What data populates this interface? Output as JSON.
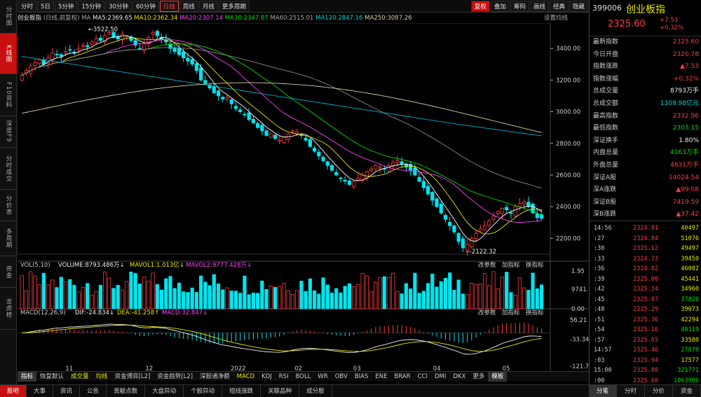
{
  "sidebar": {
    "items": [
      "分时图",
      "K线图",
      "F10资料",
      "深度F9",
      "分时成交",
      "分价表",
      "多周期",
      "资金",
      "龙虎榜"
    ]
  },
  "toolbar": {
    "periods": [
      "分时",
      "5日",
      "5分钟",
      "15分钟",
      "30分钟",
      "60分钟",
      "日线",
      "周线",
      "月线",
      "更多周期"
    ],
    "selected_period": "日线",
    "right_buttons": [
      "复权",
      "叠加",
      "筹码",
      "画线",
      "经典",
      "隐藏"
    ]
  },
  "legend": {
    "index_name": "创业板指",
    "mode": "(日线,前复权)",
    "ma_label": "MA",
    "ma5": "MA5:2369.65",
    "ma10": "MA10:2362.34",
    "ma20": "MA20:2307.14",
    "ma30": "MA30:2347.87",
    "ma60": "MA60:2515.01",
    "ma120": "MA120:2847.16",
    "ma250": "MA250:3087.26",
    "settings": "设置均线"
  },
  "price_axis": [
    "3400.00",
    "3200.00",
    "3000.00",
    "2800.00",
    "2600.00",
    "2400.00",
    "2200.00"
  ],
  "annotations": {
    "high": "3522.50",
    "low": "2122.32"
  },
  "volume_panel": {
    "title": "VOL(5,10)",
    "volume": "VOLUME:8793.486万",
    "mavol1": "MAVOL1:1.013亿",
    "mavol2": "MAVOL2:9777.428万",
    "buttons": [
      "改参数",
      "加指标",
      "换指标"
    ],
    "axis": [
      "1.95",
      "9741.00",
      "0.00"
    ]
  },
  "macd_panel": {
    "title": "MACD(12,26,9)",
    "dif": "DIF:-24.834",
    "dea": "DEA:-41.258",
    "macd": "MACD:32.847",
    "buttons": [
      "改参数",
      "加指标",
      "换指标"
    ],
    "axis": [
      "56.21",
      "-33.34",
      "-121.77"
    ]
  },
  "date_axis": [
    "11",
    "12",
    "2022",
    "02",
    "03",
    "04",
    "05"
  ],
  "indicator_tabs": [
    "指标",
    "恢复默认",
    "成交量",
    "均线",
    "资金博弈[L2]",
    "资金趋势[L2]",
    "深股通净额",
    "MACD",
    "KDJ",
    "RSI",
    "BOLL",
    "WR",
    "OBV",
    "BIAS",
    "ENE",
    "BRAR",
    "CCI",
    "DMI",
    "DKX",
    "更多",
    "模板"
  ],
  "bottom_nav": [
    "股吧",
    "大事",
    "资讯",
    "公告",
    "贡献点数",
    "大盘异动",
    "个股异动",
    "短线涨跌",
    "关联品种",
    "成分股"
  ],
  "quote": {
    "code": "399006",
    "name": "创业板指",
    "price": "2325.60",
    "change": "+7.53",
    "pct": "+0.32%",
    "rows": [
      {
        "label": "最新指数",
        "value": "2325.60",
        "color": "red"
      },
      {
        "label": "今日开盘",
        "value": "2320.78",
        "color": "red"
      },
      {
        "label": "指数涨跌",
        "value": "▲7.53",
        "color": "red"
      },
      {
        "label": "指数涨幅",
        "value": "+0.32%",
        "color": "red"
      },
      {
        "label": "总成交量",
        "value": "8793万手",
        "color": "wht"
      },
      {
        "label": "总成交额",
        "value": "1309.98亿元",
        "color": "cyn"
      },
      {
        "label": "最高指数",
        "value": "2332.96",
        "color": "red"
      },
      {
        "label": "最低指数",
        "value": "2303.15",
        "color": "grn"
      },
      {
        "label": "深证换手",
        "value": "1.80%",
        "color": "wht"
      },
      {
        "label": "内盘总量",
        "value": "4163万手",
        "color": "grn"
      },
      {
        "label": "外盘总量",
        "value": "4631万手",
        "color": "red"
      },
      {
        "label": "深证A股",
        "value": "14024.54",
        "color": "red"
      },
      {
        "label": "深A涨跌",
        "value": "▲99.08",
        "color": "red"
      },
      {
        "label": "深证B股",
        "value": "7419.59",
        "color": "red"
      },
      {
        "label": "深B涨跌",
        "value": "▲37.42",
        "color": "red"
      }
    ]
  },
  "ticks": [
    {
      "t": "14:56",
      "p": "2324.81",
      "v": "40497",
      "pc": "red",
      "vc": "ylw"
    },
    {
      "t": ":27",
      "p": "2324.84",
      "v": "51076",
      "pc": "red",
      "vc": "ylw"
    },
    {
      "t": ":30",
      "p": "2325.12",
      "v": "49497",
      "pc": "red",
      "vc": "ylw"
    },
    {
      "t": ":33",
      "p": "2324.73",
      "v": "39450",
      "pc": "red",
      "vc": "ylw"
    },
    {
      "t": ":36",
      "p": "2324.82",
      "v": "46082",
      "pc": "red",
      "vc": "ylw"
    },
    {
      "t": ":39",
      "p": "2325.00",
      "v": "45441",
      "pc": "red",
      "vc": "ylw"
    },
    {
      "t": ":42",
      "p": "2325.34",
      "v": "34960",
      "pc": "red",
      "vc": "ylw"
    },
    {
      "t": ":45",
      "p": "2325.07",
      "v": "37820",
      "pc": "red",
      "vc": "grn"
    },
    {
      "t": ":48",
      "p": "2325.29",
      "v": "39073",
      "pc": "red",
      "vc": "ylw"
    },
    {
      "t": ":51",
      "p": "2325.36",
      "v": "42294",
      "pc": "red",
      "vc": "ylw"
    },
    {
      "t": ":54",
      "p": "2325.16",
      "v": "40119",
      "pc": "red",
      "vc": "grn"
    },
    {
      "t": ":57",
      "p": "2325.65",
      "v": "33580",
      "pc": "red",
      "vc": "ylw"
    },
    {
      "t": "14:57",
      "p": "2325.46",
      "v": "27870",
      "pc": "red",
      "vc": "grn"
    },
    {
      "t": ":03",
      "p": "2325.94",
      "v": "17577",
      "pc": "red",
      "vc": "ylw"
    },
    {
      "t": "15:00",
      "p": "2325.80",
      "v": "321771",
      "pc": "red",
      "vc": "grn"
    },
    {
      "t": ":00",
      "p": "2325.60",
      "v": "1063986",
      "pc": "red",
      "vc": "grn"
    }
  ],
  "right_bottom_tabs": [
    "分笔",
    "分时",
    "分价",
    "资金"
  ],
  "colors": {
    "up": "#ff3b3b",
    "down": "#00e5ee",
    "ma5": "#ffffff",
    "ma10": "#e8e800",
    "ma20": "#ff40ff",
    "ma30": "#00e000",
    "ma60": "#888888",
    "ma120": "#00b0d0",
    "ma250": "#d8d0a0"
  },
  "chart_data": {
    "type": "candlestick",
    "title": "",
    "y_ticks": [
      2200,
      2400,
      2600,
      2800,
      3000,
      3200,
      3400
    ],
    "ylim": [
      2100,
      3560
    ],
    "close": [
      3230,
      3260,
      3290,
      3310,
      3330,
      3300,
      3340,
      3370,
      3360,
      3350,
      3380,
      3390,
      3370,
      3400,
      3420,
      3410,
      3440,
      3460,
      3450,
      3480,
      3500,
      3470,
      3460,
      3490,
      3480,
      3450,
      3420,
      3400,
      3430,
      3470,
      3500,
      3480,
      3460,
      3440,
      3400,
      3380,
      3360,
      3340,
      3320,
      3300,
      3260,
      3200,
      3180,
      3150,
      3120,
      3100,
      3080,
      3090,
      3050,
      3020,
      3000,
      2980,
      2950,
      2930,
      2900,
      2880,
      2850,
      2860,
      2830,
      2820,
      2840,
      2860,
      2880,
      2870,
      2850,
      2820,
      2780,
      2750,
      2720,
      2690,
      2660,
      2630,
      2600,
      2580,
      2560,
      2540,
      2560,
      2580,
      2600,
      2620,
      2640,
      2660,
      2650,
      2640,
      2660,
      2680,
      2690,
      2670,
      2650,
      2630,
      2600,
      2560,
      2520,
      2480,
      2440,
      2400,
      2360,
      2320,
      2280,
      2240,
      2180,
      2140,
      2160,
      2200,
      2230,
      2260,
      2280,
      2310,
      2340,
      2370,
      2390,
      2380,
      2360,
      2400,
      2420,
      2430,
      2400,
      2360,
      2330,
      2326
    ]
  }
}
